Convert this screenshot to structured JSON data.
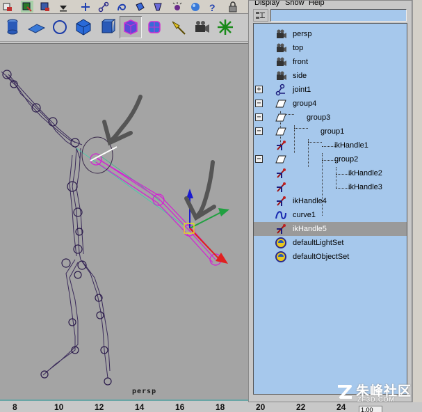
{
  "outliner": {
    "menu": [
      "Display",
      "Show",
      "Help"
    ],
    "filter_value": "",
    "items": [
      {
        "label": "persp",
        "icon": "camera-icon"
      },
      {
        "label": "top",
        "icon": "camera-icon"
      },
      {
        "label": "front",
        "icon": "camera-icon"
      },
      {
        "label": "side",
        "icon": "camera-icon"
      },
      {
        "label": "joint1",
        "icon": "joint-icon",
        "expander": "+"
      },
      {
        "label": "group4",
        "icon": "group-icon",
        "expander": "−"
      },
      {
        "label": "group3",
        "icon": "group-icon",
        "expander": "−"
      },
      {
        "label": "group1",
        "icon": "group-icon",
        "expander": "−"
      },
      {
        "label": "ikHandle1",
        "icon": "ik-handle-icon"
      },
      {
        "label": "group2",
        "icon": "group-icon",
        "expander": "−"
      },
      {
        "label": "ikHandle2",
        "icon": "ik-handle-icon"
      },
      {
        "label": "ikHandle3",
        "icon": "ik-handle-icon"
      },
      {
        "label": "ikHandle4",
        "icon": "ik-handle-icon"
      },
      {
        "label": "curve1",
        "icon": "curve-icon"
      },
      {
        "label": "ikHandle5",
        "icon": "ik-handle-icon",
        "selected": true
      },
      {
        "label": "defaultLightSet",
        "icon": "set-icon"
      },
      {
        "label": "defaultObjectSet",
        "icon": "set-icon"
      }
    ]
  },
  "viewport": {
    "camera_label": "persp"
  },
  "time_slider": {
    "ticks": [
      "8",
      "10",
      "12",
      "14",
      "16",
      "18",
      "20",
      "22",
      "24"
    ],
    "range_value": "1.00"
  },
  "watermark": {
    "text": "朱峰社区",
    "url": "ZF3D.COM"
  },
  "colors": {
    "outliner_bg": "#a6c8ec",
    "viewport_bg": "#a4a4a4",
    "selection": "#9a9a9a",
    "skeleton": "#3a2a5a",
    "ik_chain": "#d41fd4"
  }
}
